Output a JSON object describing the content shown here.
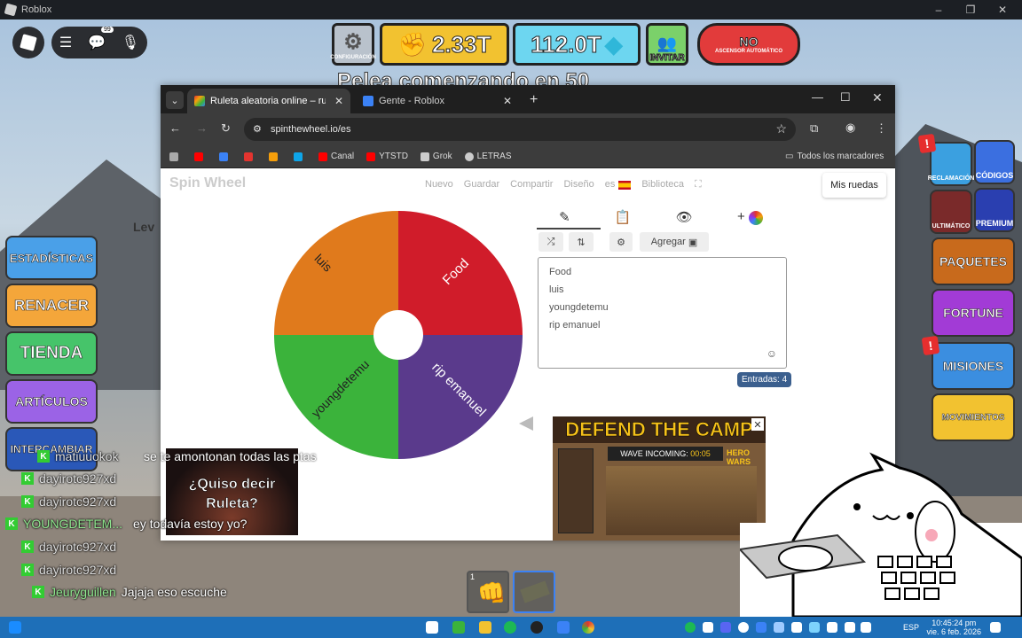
{
  "window": {
    "title": "Roblox"
  },
  "roblox_menu": {
    "notif_badge": "99"
  },
  "hud": {
    "settings_label": "CONFIGURACIÓN",
    "coins": "2.33T",
    "gems": "112.0T",
    "invite": "INVITAR",
    "auto": "NO",
    "auto_sub": "ASCENSOR AUTOMÁTICO",
    "banner": "Pelea comenzando en 50"
  },
  "left_buttons": [
    "ESTADÍSTICAS",
    "RENACER",
    "TIENDA",
    "ARTÍCULOS",
    "INTERCAMBIAR"
  ],
  "level_label": "Lev",
  "right_buttons": {
    "reclamacion": "RECLAMACIÓN",
    "codigos": "CÓDIGOS",
    "ultimatico": "ULTIMÁTICO",
    "premium": "PREMIUM",
    "paquetes": "PAQUETES",
    "fortune": "FORTUNE",
    "misiones": "MISIONES",
    "movimientos": "MOVIMIENTOS"
  },
  "browser": {
    "tabs": [
      {
        "label": "Ruleta aleatoria online – ruleta",
        "active": true,
        "color": "#e3342f"
      },
      {
        "label": "Gente - Roblox",
        "active": false,
        "color": "#3b82f6"
      }
    ],
    "url": "spinthewheel.io/es",
    "bookmarks": [
      {
        "label": "",
        "color": "#aaaaaa"
      },
      {
        "label": "",
        "color": "#ff0000"
      },
      {
        "label": "",
        "color": "#3b82f6"
      },
      {
        "label": "",
        "color": "#e3342f"
      },
      {
        "label": "",
        "color": "#f59e0b"
      },
      {
        "label": "",
        "color": "#0ea5e9"
      },
      {
        "label": "Canal",
        "color": "#ff0000"
      },
      {
        "label": "YTSTD",
        "color": "#ff0000"
      },
      {
        "label": "Grok",
        "color": "#cccccc"
      },
      {
        "label": "LETRAS",
        "color": "#cccccc"
      }
    ],
    "all_bookmarks": "Todos los marcadores"
  },
  "site": {
    "logo": "Spin Wheel",
    "nav": [
      "Nuevo",
      "Guardar",
      "Compartir",
      "Diseño",
      "es",
      "Biblioteca"
    ],
    "my_wheels": "Mis ruedas",
    "add_button": "Agregar",
    "entries": [
      "Food",
      "luis",
      "youngdetemu",
      "rip emanuel"
    ],
    "entries_count": "Entradas: 4",
    "wheel_segments": [
      {
        "label": "Food",
        "color": "#d01c2a"
      },
      {
        "label": "rip emanuel",
        "color": "#5a3a8c"
      },
      {
        "label": "youngdetemu",
        "color": "#3bb33b"
      },
      {
        "label": "luis",
        "color": "#e07a1c"
      }
    ]
  },
  "ad": {
    "title": "DEFEND THE CAMP",
    "wave": "WAVE INCOMING:",
    "timer": "00:05",
    "brand": "HERO WARS"
  },
  "meme": {
    "text": "¿Quiso decir Ruleta?"
  },
  "chat": [
    {
      "user": "matiuuokok",
      "msg": "se te amontonan todas las ptas"
    },
    {
      "user": "dayirotc927xd",
      "msg": ""
    },
    {
      "user": "dayirotc927xd",
      "msg": ""
    },
    {
      "user": "YOUNGDETEM...",
      "msg": "ey todavía estoy yo?"
    },
    {
      "user": "dayirotc927xd",
      "msg": ""
    },
    {
      "user": "dayirotc927xd",
      "msg": ""
    },
    {
      "user": "Jeuryguillen",
      "msg": "Jajaja eso escuche"
    }
  ],
  "hotbar": {
    "slot1_num": "1"
  },
  "taskbar": {
    "lang": "ESP",
    "time": "10:45:24 pm",
    "date": "vie. 6 feb. 2026"
  }
}
